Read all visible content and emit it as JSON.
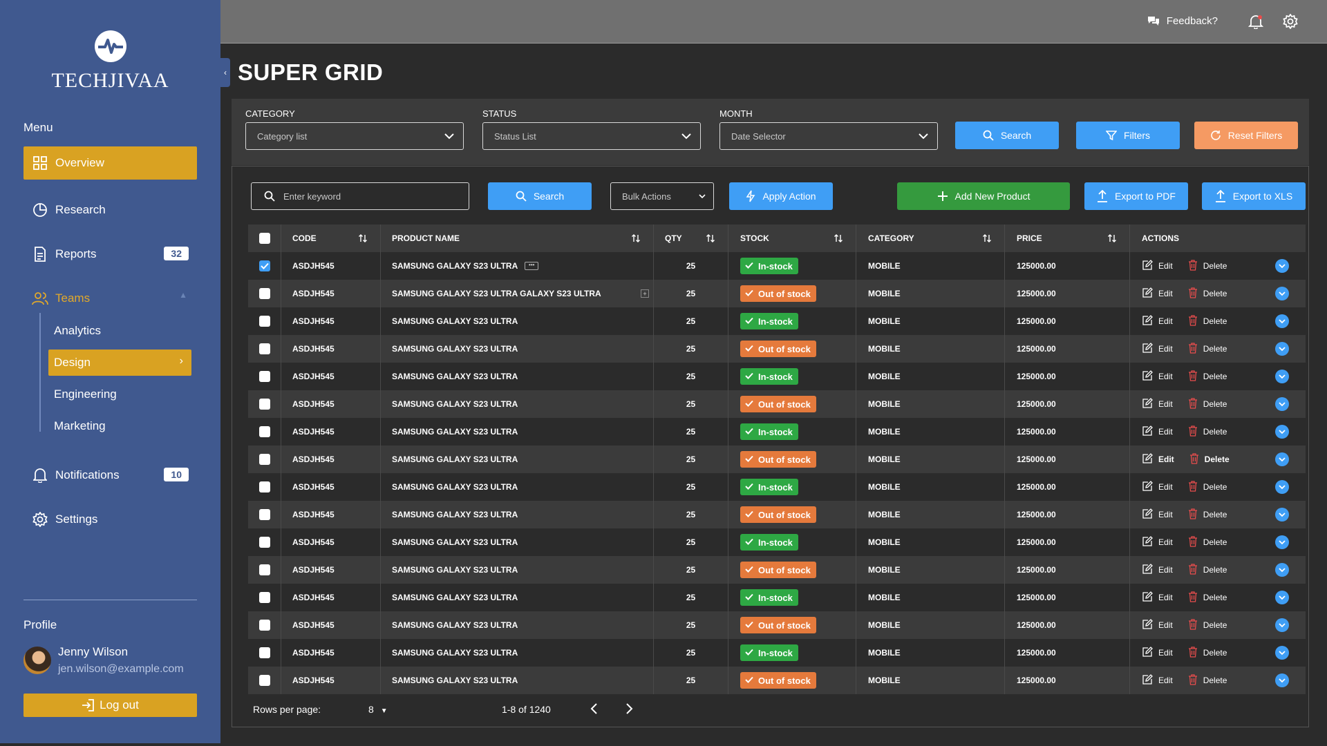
{
  "brand": {
    "name": "TECHJIVAA"
  },
  "sidebar": {
    "menu_title": "Menu",
    "items": [
      {
        "label": "Overview"
      },
      {
        "label": "Research"
      },
      {
        "label": "Reports",
        "badge": "32"
      },
      {
        "label": "Teams"
      },
      {
        "label": "Notifications",
        "badge": "10"
      },
      {
        "label": "Settings"
      }
    ],
    "team_subitems": [
      {
        "label": "Analytics"
      },
      {
        "label": "Design"
      },
      {
        "label": "Engineering"
      },
      {
        "label": "Marketing"
      }
    ],
    "profile_title": "Profile",
    "profile": {
      "name": "Jenny Wilson",
      "email": "jen.wilson@example.com"
    },
    "logout_label": "Log out"
  },
  "topbar": {
    "feedback_label": "Feedback?"
  },
  "page": {
    "title": "SUPER GRID"
  },
  "filters": {
    "category_label": "CATEGORY",
    "category_value": "Category list",
    "status_label": "STATUS",
    "status_value": "Status List",
    "month_label": "MONTH",
    "month_value": "Date Selector",
    "search_label": "Search",
    "filters_label": "Filters",
    "reset_label": "Reset Filters"
  },
  "toolbar": {
    "keyword_placeholder": "Enter keyword",
    "search_label": "Search",
    "bulk_label": "Bulk Actions",
    "apply_label": "Apply Action",
    "add_label": "Add New Product",
    "pdf_label": "Export to PDF",
    "xls_label": "Export to XLS"
  },
  "table": {
    "columns": [
      "CODE",
      "PRODUCT NAME",
      "QTY",
      "STOCK",
      "CATEGORY",
      "PRICE",
      "ACTIONS"
    ],
    "edit_label": "Edit",
    "delete_label": "Delete",
    "rows": [
      {
        "code": "ASDJH545",
        "name": "SAMSUNG GALAXY S23 ULTRA",
        "qty": "25",
        "stock": "In-stock",
        "category": "MOBILE",
        "price": "125000.00",
        "checked": true
      },
      {
        "code": "ASDJH545",
        "name": "SAMSUNG GALAXY S23 ULTRA GALAXY S23 ULTRA",
        "qty": "25",
        "stock": "Out of stock",
        "category": "MOBILE",
        "price": "125000.00",
        "checked": false
      },
      {
        "code": "ASDJH545",
        "name": "SAMSUNG GALAXY S23 ULTRA",
        "qty": "25",
        "stock": "In-stock",
        "category": "MOBILE",
        "price": "125000.00",
        "checked": false
      },
      {
        "code": "ASDJH545",
        "name": "SAMSUNG GALAXY S23 ULTRA",
        "qty": "25",
        "stock": "Out of stock",
        "category": "MOBILE",
        "price": "125000.00",
        "checked": false
      },
      {
        "code": "ASDJH545",
        "name": "SAMSUNG GALAXY S23 ULTRA",
        "qty": "25",
        "stock": "In-stock",
        "category": "MOBILE",
        "price": "125000.00",
        "checked": false
      },
      {
        "code": "ASDJH545",
        "name": "SAMSUNG GALAXY S23 ULTRA",
        "qty": "25",
        "stock": "Out of stock",
        "category": "MOBILE",
        "price": "125000.00",
        "checked": false
      },
      {
        "code": "ASDJH545",
        "name": "SAMSUNG GALAXY S23 ULTRA",
        "qty": "25",
        "stock": "In-stock",
        "category": "MOBILE",
        "price": "125000.00",
        "checked": false
      },
      {
        "code": "ASDJH545",
        "name": "SAMSUNG GALAXY S23 ULTRA",
        "qty": "25",
        "stock": "Out of stock",
        "category": "MOBILE",
        "price": "125000.00",
        "checked": false
      },
      {
        "code": "ASDJH545",
        "name": "SAMSUNG GALAXY S23 ULTRA",
        "qty": "25",
        "stock": "In-stock",
        "category": "MOBILE",
        "price": "125000.00",
        "checked": false
      },
      {
        "code": "ASDJH545",
        "name": "SAMSUNG GALAXY S23 ULTRA",
        "qty": "25",
        "stock": "Out of stock",
        "category": "MOBILE",
        "price": "125000.00",
        "checked": false
      },
      {
        "code": "ASDJH545",
        "name": "SAMSUNG GALAXY S23 ULTRA",
        "qty": "25",
        "stock": "In-stock",
        "category": "MOBILE",
        "price": "125000.00",
        "checked": false
      },
      {
        "code": "ASDJH545",
        "name": "SAMSUNG GALAXY S23 ULTRA",
        "qty": "25",
        "stock": "Out of stock",
        "category": "MOBILE",
        "price": "125000.00",
        "checked": false
      },
      {
        "code": "ASDJH545",
        "name": "SAMSUNG GALAXY S23 ULTRA",
        "qty": "25",
        "stock": "In-stock",
        "category": "MOBILE",
        "price": "125000.00",
        "checked": false
      },
      {
        "code": "ASDJH545",
        "name": "SAMSUNG GALAXY S23 ULTRA",
        "qty": "25",
        "stock": "Out of stock",
        "category": "MOBILE",
        "price": "125000.00",
        "checked": false
      },
      {
        "code": "ASDJH545",
        "name": "SAMSUNG GALAXY S23 ULTRA",
        "qty": "25",
        "stock": "In-stock",
        "category": "MOBILE",
        "price": "125000.00",
        "checked": false
      },
      {
        "code": "ASDJH545",
        "name": "SAMSUNG GALAXY S23 ULTRA",
        "qty": "25",
        "stock": "Out of stock",
        "category": "MOBILE",
        "price": "125000.00",
        "checked": false
      }
    ]
  },
  "pagination": {
    "rows_per_page_label": "Rows per page:",
    "rows_per_page_value": "8",
    "range": "1-8 of 1240"
  },
  "colors": {
    "sidebar": "#40598f",
    "accent": "#d9a222",
    "primary": "#3f9ef5",
    "success": "#2ea844",
    "danger": "#e57a3c",
    "green_button": "#359a3e",
    "reset": "#f59a63"
  }
}
